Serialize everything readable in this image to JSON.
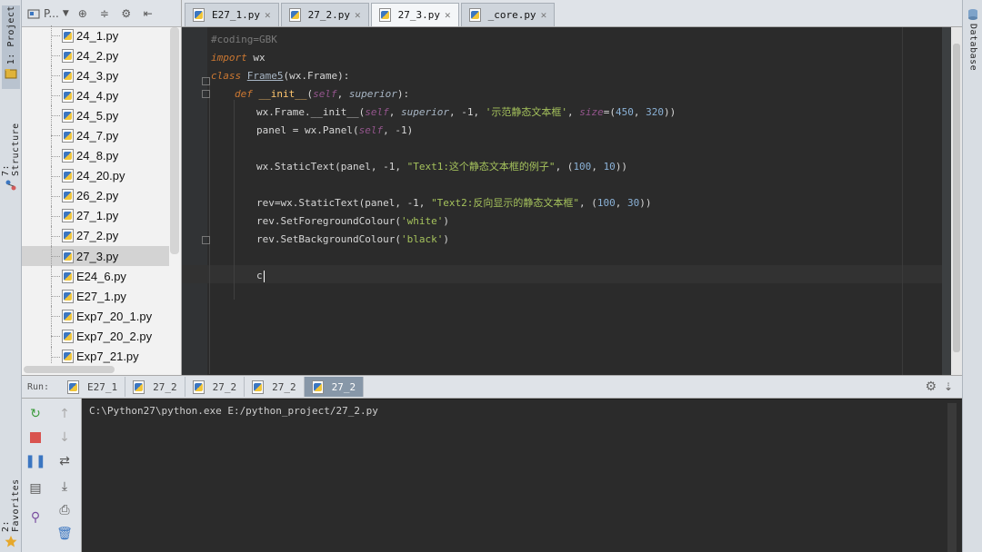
{
  "left_strip": {
    "project_tab": "1: Project",
    "structure_tab": "7: Structure",
    "favorites_tab": "2: Favorites"
  },
  "right_strip": {
    "database_tab": "Database"
  },
  "project_panel": {
    "title": "P...",
    "files": [
      {
        "name": "24_1.py"
      },
      {
        "name": "24_2.py"
      },
      {
        "name": "24_3.py"
      },
      {
        "name": "24_4.py"
      },
      {
        "name": "24_5.py"
      },
      {
        "name": "24_7.py"
      },
      {
        "name": "24_8.py"
      },
      {
        "name": "24_20.py"
      },
      {
        "name": "26_2.py"
      },
      {
        "name": "27_1.py"
      },
      {
        "name": "27_2.py"
      },
      {
        "name": "27_3.py",
        "selected": true
      },
      {
        "name": "E24_6.py"
      },
      {
        "name": "E27_1.py"
      },
      {
        "name": "Exp7_20_1.py"
      },
      {
        "name": "Exp7_20_2.py"
      },
      {
        "name": "Exp7_21.py"
      }
    ]
  },
  "editor_tabs": [
    {
      "label": "E27_1.py",
      "active": false
    },
    {
      "label": "27_2.py",
      "active": false
    },
    {
      "label": "27_3.py",
      "active": true
    },
    {
      "label": "_core.py",
      "active": false
    }
  ],
  "code": {
    "l1": "#coding=GBK",
    "l2_kw": "import",
    "l2_rest": " wx",
    "l3_kw": "class",
    "l3_name": "Frame5",
    "l3_rest": "(wx.Frame):",
    "l4_kw": "def",
    "l4_name": "__init__",
    "l4_open": "(",
    "l4_self": "self",
    "l4_comma": ", ",
    "l4_param": "superior",
    "l4_close": "):",
    "l5_a": "wx.Frame.__init__(",
    "l5_self": "self",
    "l5_b": ", ",
    "l5_param": "superior",
    "l5_c": ", -1, ",
    "l5_str": "'示范静态文本框'",
    "l5_d": ", ",
    "l5_size": "size",
    "l5_e": "=(",
    "l5_n1": "450",
    "l5_f": ", ",
    "l5_n2": "320",
    "l5_g": "))",
    "l6_a": "panel = wx.Panel(",
    "l6_self": "self",
    "l6_b": ", -1)",
    "l7_a": "wx.StaticText(panel, -1, ",
    "l7_str": "\"Text1:这个静态文本框的例子\"",
    "l7_b": ", (",
    "l7_n1": "100",
    "l7_c": ", ",
    "l7_n2": "10",
    "l7_d": "))",
    "l8_a": "rev=wx.StaticText(panel, -1, ",
    "l8_str": "\"Text2:反向显示的静态文本框\"",
    "l8_b": ", (",
    "l8_n1": "100",
    "l8_c": ", ",
    "l8_n2": "30",
    "l8_d": "))",
    "l9_a": "rev.SetForegroundColour(",
    "l9_str": "'white'",
    "l9_b": ")",
    "l10_a": "rev.SetBackgroundColour(",
    "l10_str": "'black'",
    "l10_b": ")",
    "l11": "c"
  },
  "run_panel": {
    "label": "Run:",
    "tabs": [
      {
        "label": "E27_1",
        "active": false
      },
      {
        "label": "27_2",
        "active": false
      },
      {
        "label": "27_2",
        "active": false
      },
      {
        "label": "27_2",
        "active": false
      },
      {
        "label": "27_2",
        "active": true
      }
    ],
    "console_line": "C:\\Python27\\python.exe E:/python_project/27_2.py"
  },
  "colors": {
    "editor_bg": "#2b2b2b",
    "keyword": "#cc7832",
    "string": "#a5c25c",
    "number": "#8ab1d6"
  }
}
